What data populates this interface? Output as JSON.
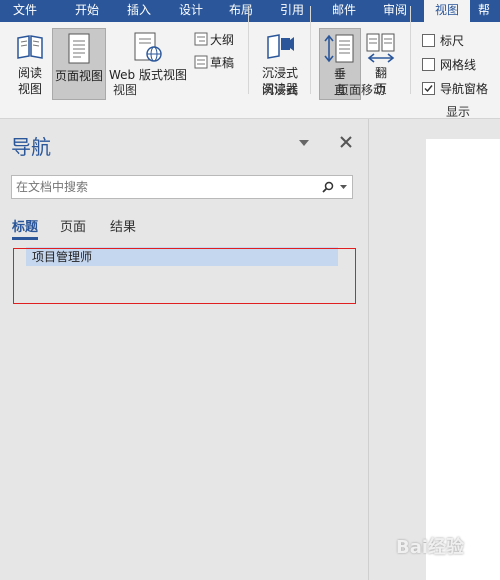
{
  "ribbon_tabs": [
    "文件",
    "开始",
    "插入",
    "设计",
    "布局",
    "引用",
    "邮件",
    "审阅",
    "视图",
    "帮"
  ],
  "active_tab_index": 8,
  "ribbon": {
    "views": {
      "read_mode": [
        "阅读",
        "视图"
      ],
      "print_layout": "页面视图",
      "web_layout": "Web 版式视图",
      "outline": "大纲",
      "draft": "草稿",
      "group_label": "视图"
    },
    "immersive": {
      "immersive_reader": [
        "沉浸式",
        "阅读器"
      ],
      "group_label": "沉浸式"
    },
    "page_movement": {
      "vertical": [
        "垂",
        "直"
      ],
      "side_to_side": [
        "翻",
        "页"
      ],
      "group_label": "页面移动"
    },
    "show": {
      "ruler": {
        "label": "标尺",
        "checked": false
      },
      "gridlines": {
        "label": "网格线",
        "checked": false
      },
      "navigation_pane": {
        "label": "导航窗格",
        "checked": true
      },
      "group_label": "显示"
    }
  },
  "nav_pane": {
    "title": "导航",
    "search_placeholder": "在文档中搜索",
    "tabs": [
      "标题",
      "页面",
      "结果"
    ],
    "active_tab_index": 0,
    "headings": [
      "项目管理师"
    ]
  },
  "watermark": "Bai经验",
  "colors": {
    "ribbon_blue": "#2b579a",
    "highlight_red": "#e02020",
    "selection": "#c5d7ef"
  }
}
